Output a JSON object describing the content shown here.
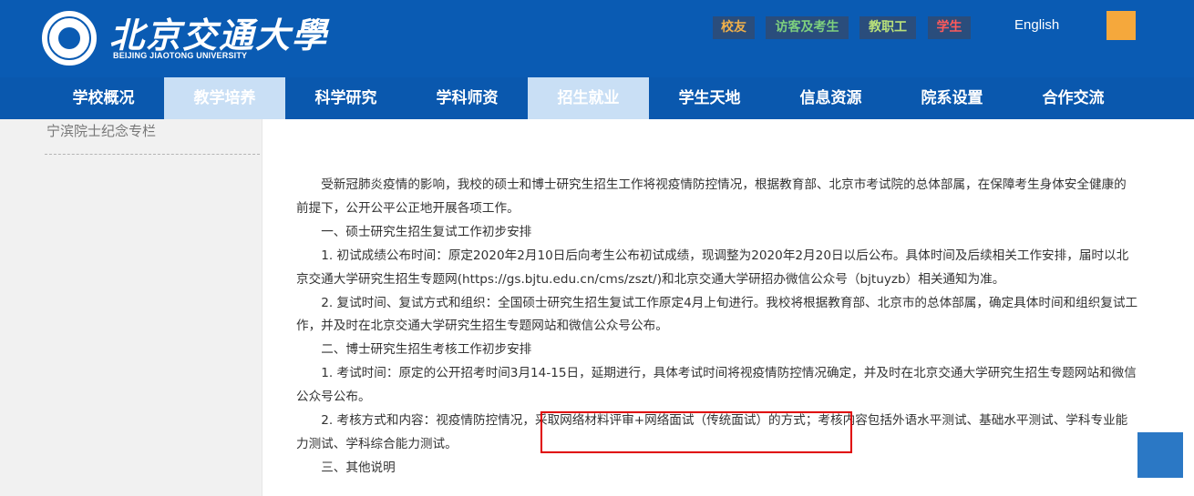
{
  "header": {
    "logo_cn": "北京交通大學",
    "logo_en": "BEIJING JIAOTONG UNIVERSITY",
    "top_links": [
      "校友",
      "访客及考生",
      "教职工",
      "学生"
    ],
    "english_label": "English",
    "accent_colors": {
      "blue": "#0a5bb3",
      "orange": "#f5a83c",
      "highlight_red": "#e00000"
    }
  },
  "nav": {
    "items": [
      "学校概况",
      "教学培养",
      "科学研究",
      "学科师资",
      "招生就业",
      "学生天地",
      "信息资源",
      "院系设置",
      "合作交流"
    ]
  },
  "sidebar": {
    "link": "宁滨院士纪念专栏"
  },
  "article": {
    "paragraphs": [
      "受新冠肺炎疫情的影响，我校的硕士和博士研究生招生工作将视疫情防控情况，根据教育部、北京市考试院的总体部属，在保障考生身体安全健康的前提下，公开公平公正地开展各项工作。",
      "一、硕士研究生招生复试工作初步安排",
      "1. 初试成绩公布时间：原定2020年2月10日后向考生公布初试成绩，现调整为2020年2月20日以后公布。具体时间及后续相关工作安排，届时以北京交通大学研究生招生专题网(https://gs.bjtu.edu.cn/cms/zszt/)和北京交通大学研招办微信公众号（bjtuyzb）相关通知为准。",
      "2. 复试时间、复试方式和组织：全国硕士研究生招生复试工作原定4月上旬进行。我校将根据教育部、北京市的总体部属，确定具体时间和组织复试工作，并及时在北京交通大学研究生招生专题网站和微信公众号公布。",
      "二、博士研究生招生考核工作初步安排",
      "1. 考试时间：原定的公开招考时间3月14-15日，延期进行，具体考试时间将视疫情防控情况确定，并及时在北京交通大学研究生招生专题网站和微信公众号公布。",
      "2. 考核方式和内容：视疫情防控情况，采取网络材料评审+网络面试（传统面试）的方式；考核内容包括外语水平测试、基础水平测试、学科专业能力测试、学科综合能力测试。",
      "三、其他说明"
    ]
  }
}
